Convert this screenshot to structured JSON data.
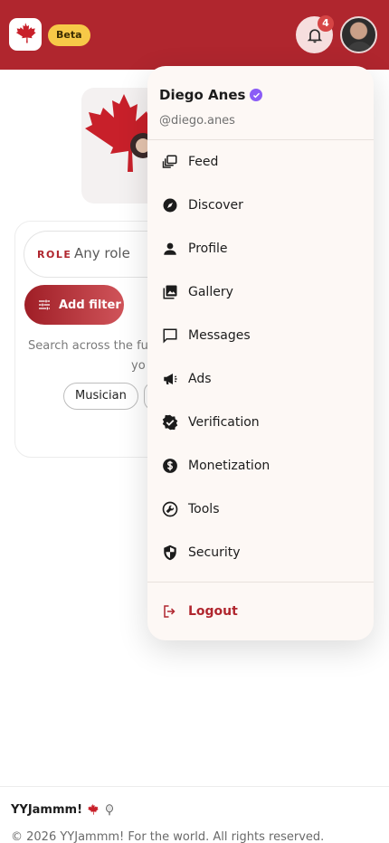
{
  "header": {
    "beta_label": "Beta",
    "notification_count": "4",
    "brand_color": "#b0262e"
  },
  "filters": {
    "role_label": "ROLE",
    "role_value": "Any role",
    "add_filter_label": "Add filter",
    "search_hint_line1": "Search across the fu",
    "search_hint_line2": "yo",
    "chips": [
      "Musician"
    ]
  },
  "menu": {
    "user_name": "Diego Anes",
    "user_handle": "@diego.anes",
    "items": [
      {
        "label": "Feed",
        "icon": "feed-icon"
      },
      {
        "label": "Discover",
        "icon": "compass-icon"
      },
      {
        "label": "Profile",
        "icon": "person-icon"
      },
      {
        "label": "Gallery",
        "icon": "image-icon"
      },
      {
        "label": "Messages",
        "icon": "chat-icon"
      },
      {
        "label": "Ads",
        "icon": "megaphone-icon"
      },
      {
        "label": "Verification",
        "icon": "verified-badge-icon"
      },
      {
        "label": "Monetization",
        "icon": "dollar-icon"
      },
      {
        "label": "Tools",
        "icon": "wrench-icon"
      },
      {
        "label": "Security",
        "icon": "shield-icon"
      }
    ],
    "logout_label": "Logout"
  },
  "footer": {
    "brand": "YYJammm!",
    "copyright": "© 2026 YYJammm! For the world. All rights reserved."
  }
}
